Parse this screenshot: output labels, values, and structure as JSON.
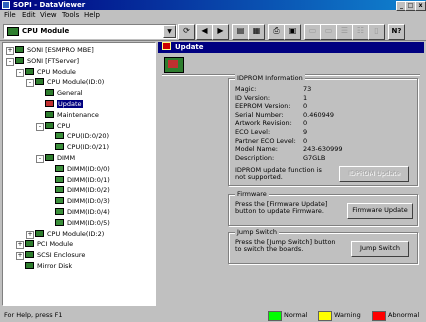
{
  "window": {
    "title": "SOPI - DataViewer",
    "minimize": "_",
    "maximize": "□",
    "close": "x"
  },
  "menu": [
    "File",
    "Edit",
    "View",
    "Tools",
    "Help"
  ],
  "toolbar": {
    "combo_value": "CPU Module"
  },
  "tree": {
    "items": [
      {
        "label": "SONI [ESMPRO MBE]",
        "level": 0,
        "exp": "+"
      },
      {
        "label": "SONI [FTServer]",
        "level": 0,
        "exp": "-"
      },
      {
        "label": "CPU Module",
        "level": 1,
        "exp": "-"
      },
      {
        "label": "CPU Module(ID:0)",
        "level": 2,
        "exp": "-"
      },
      {
        "label": "General",
        "level": 3
      },
      {
        "label": "Update",
        "level": 3,
        "selected": true
      },
      {
        "label": "Maintenance",
        "level": 3
      },
      {
        "label": "CPU",
        "level": 3,
        "exp": "-"
      },
      {
        "label": "CPU(ID:0/20)",
        "level": 4
      },
      {
        "label": "CPU(ID:0/21)",
        "level": 4
      },
      {
        "label": "DIMM",
        "level": 3,
        "exp": "-"
      },
      {
        "label": "DIMM(ID:0/0)",
        "level": 4
      },
      {
        "label": "DIMM(ID:0/1)",
        "level": 4
      },
      {
        "label": "DIMM(ID:0/2)",
        "level": 4
      },
      {
        "label": "DIMM(ID:0/3)",
        "level": 4
      },
      {
        "label": "DIMM(ID:0/4)",
        "level": 4
      },
      {
        "label": "DIMM(ID:0/5)",
        "level": 4
      },
      {
        "label": "CPU Module(ID:2)",
        "level": 2,
        "exp": "+"
      },
      {
        "label": "PCI Module",
        "level": 1,
        "exp": "+"
      },
      {
        "label": "SCSI Enclosure",
        "level": 1,
        "exp": "+"
      },
      {
        "label": "Mirror Disk",
        "level": 1
      }
    ]
  },
  "pane": {
    "header": "Update",
    "idprom": {
      "title": "IDPROM Information",
      "fields": [
        {
          "label": "Magic:",
          "value": "73"
        },
        {
          "label": "ID Version:",
          "value": "1"
        },
        {
          "label": "EEPROM Version:",
          "value": "0"
        },
        {
          "label": "Serial Number:",
          "value": "0.460949"
        },
        {
          "label": "Artwork Revision:",
          "value": "0"
        },
        {
          "label": "ECO Level:",
          "value": "9"
        },
        {
          "label": "Partner ECO Level:",
          "value": "0"
        },
        {
          "label": "Model Name:",
          "value": "243-630999"
        },
        {
          "label": "Description:",
          "value": "G7GLB"
        }
      ],
      "note": "IDPROM update function is not supported.",
      "button": "IDPROM Update"
    },
    "firmware": {
      "title": "Firmware",
      "text": "Press the [Firmware Update] button to update Firmware.",
      "button": "Firmware Update"
    },
    "jump": {
      "title": "Jump Switch",
      "text": "Press the [Jump Switch] button to switch the boards.",
      "button": "Jump Switch"
    }
  },
  "status": {
    "text": "For Help, press F1",
    "legend": [
      {
        "label": "Normal",
        "color": "#00ff00"
      },
      {
        "label": "Warning",
        "color": "#ffff00"
      },
      {
        "label": "Abnormal",
        "color": "#ff0000"
      }
    ]
  }
}
